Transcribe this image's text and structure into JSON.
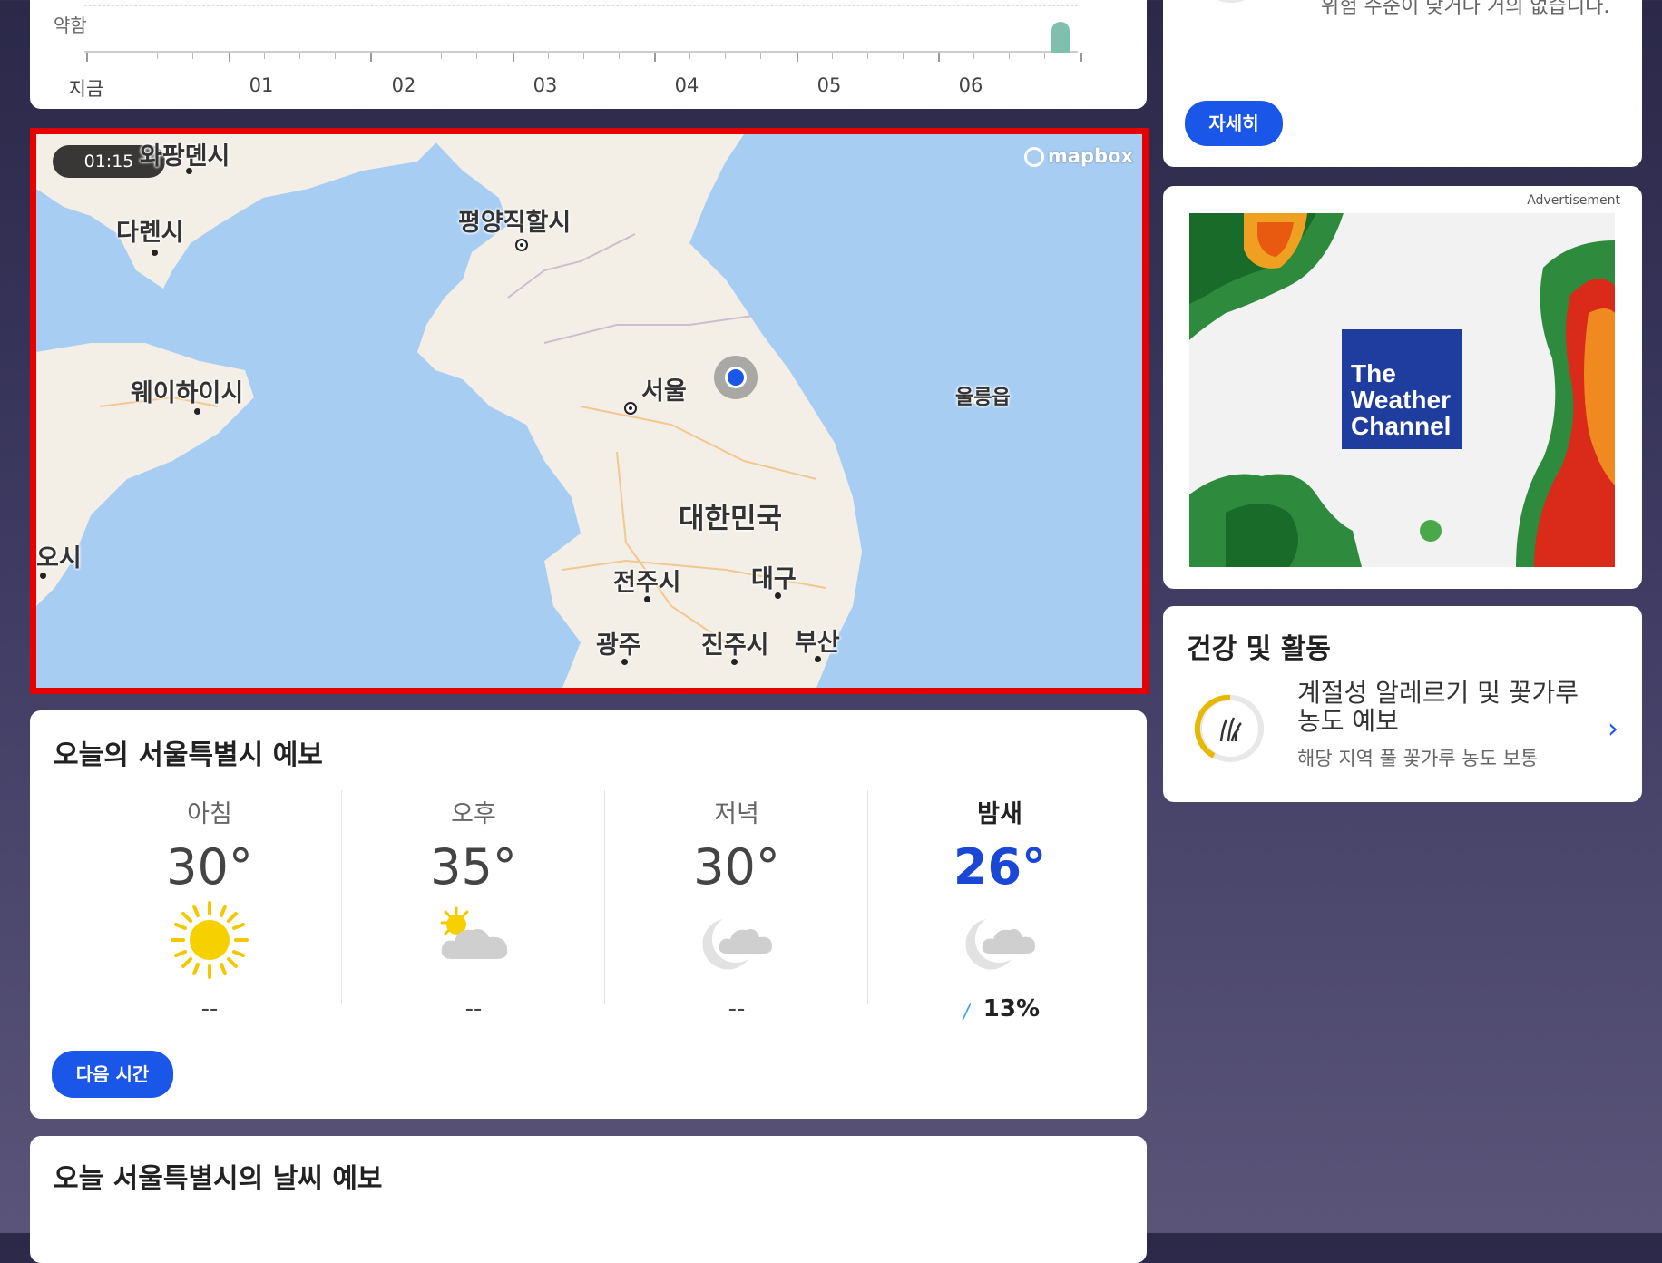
{
  "timeline": {
    "level_label": "약함",
    "hours": [
      "지금",
      "01",
      "02",
      "03",
      "04",
      "05",
      "06"
    ]
  },
  "map": {
    "time": "01:15",
    "attribution": "mapbox",
    "labels": {
      "dalian_north": "와팡뎬시",
      "dalian": "다롄시",
      "pyongyang": "평양직할시",
      "weihai": "웨이하이시",
      "seoul": "서울",
      "ulleung": "울릉읍",
      "korea": "대한민국",
      "qingdao": "오시",
      "jeonju": "전주시",
      "daegu": "대구",
      "gwangju": "광주",
      "jinju": "진주시",
      "busan": "부산"
    }
  },
  "forecast": {
    "title": "오늘의 서울특별시 예보",
    "periods": [
      {
        "label": "아침",
        "temp": "30°",
        "icon": "sun-icon",
        "precip": "--"
      },
      {
        "label": "오후",
        "temp": "35°",
        "icon": "partly-cloudy-icon",
        "precip": "--"
      },
      {
        "label": "저녁",
        "temp": "30°",
        "icon": "cloudy-night-icon",
        "precip": "--"
      },
      {
        "label": "밤새",
        "temp": "26°",
        "icon": "cloudy-night-icon",
        "precip": "13%"
      }
    ],
    "next_button": "다음 시간"
  },
  "detail": {
    "title": "오늘 서울특별시의 날씨 예보"
  },
  "uv": {
    "text": "위험 수준이 낮거나 거의 없습니다.",
    "button": "자세히"
  },
  "ad": {
    "label": "Advertisement",
    "logo_lines": [
      "The",
      "Weather",
      "Channel"
    ]
  },
  "health": {
    "title": "건강 및 활동",
    "main": "계절성 알레르기 및 꽃가루 농도 예보",
    "sub": "해당 지역 풀 꽃가루 농도 보통"
  },
  "colors": {
    "accent": "#1a56e8",
    "night_temp": "#1a47d6",
    "map_water": "#a8cdf3",
    "highlight_border": "#e60000"
  }
}
